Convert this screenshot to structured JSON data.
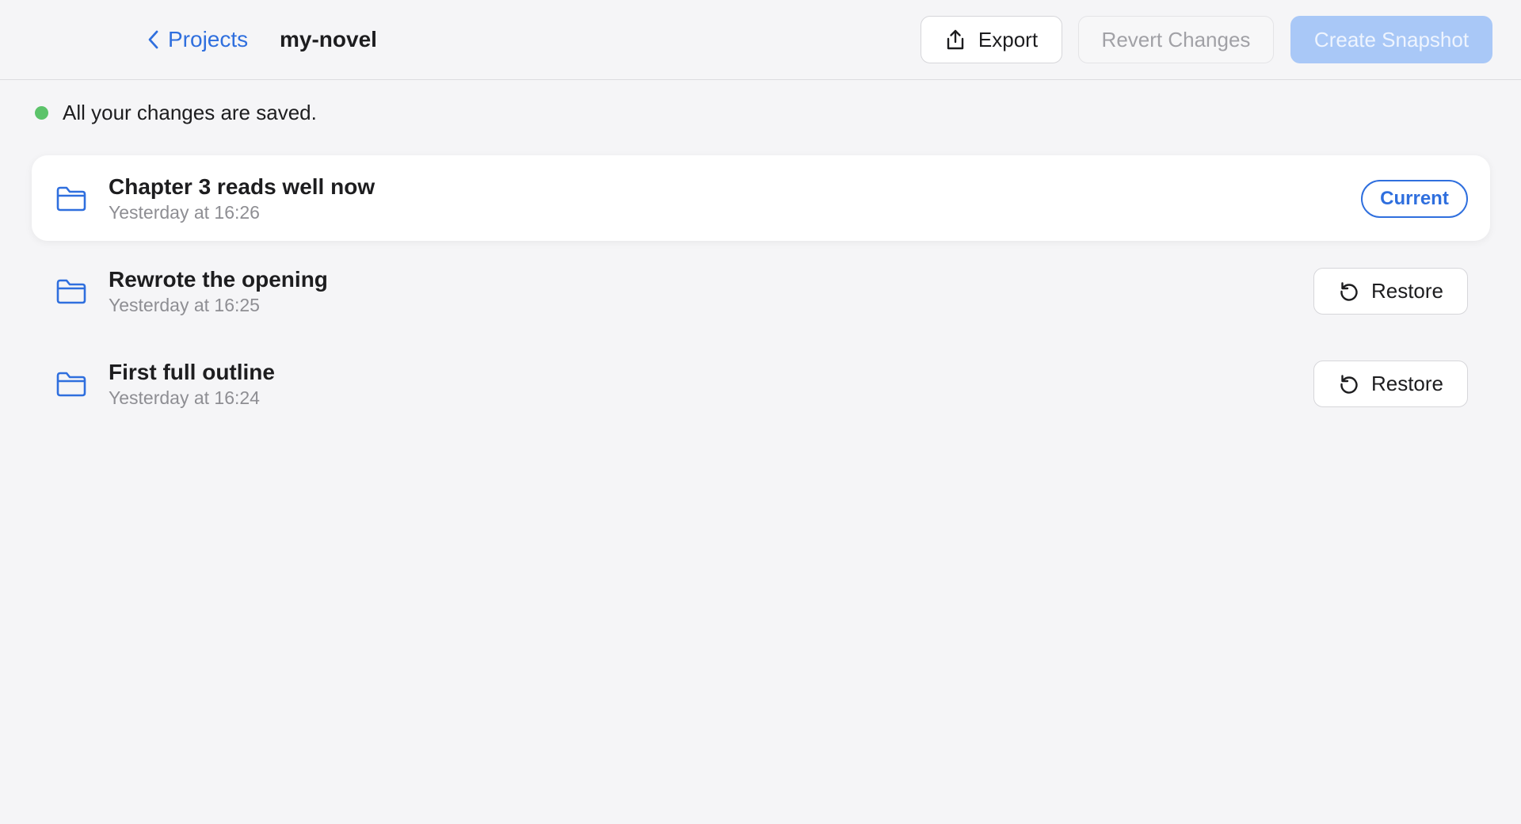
{
  "header": {
    "back_label": "Projects",
    "project_name": "my-novel",
    "export_label": "Export",
    "revert_label": "Revert Changes",
    "snapshot_label": "Create Snapshot"
  },
  "status": {
    "text": "All your changes are saved.",
    "dot_color": "#5cc36a"
  },
  "snapshots": [
    {
      "title": "Chapter 3 reads well now",
      "time": "Yesterday at 16:26",
      "badge": "Current"
    },
    {
      "title": "Rewrote the opening",
      "time": "Yesterday at 16:25",
      "action": "Restore"
    },
    {
      "title": "First full outline",
      "time": "Yesterday at 16:24",
      "action": "Restore"
    }
  ],
  "colors": {
    "accent": "#2f6fde",
    "primary_disabled": "#a9c8f7",
    "background": "#f5f5f7"
  },
  "icons": [
    "chevron-left-icon",
    "export-icon",
    "folder-icon",
    "restore-icon"
  ]
}
